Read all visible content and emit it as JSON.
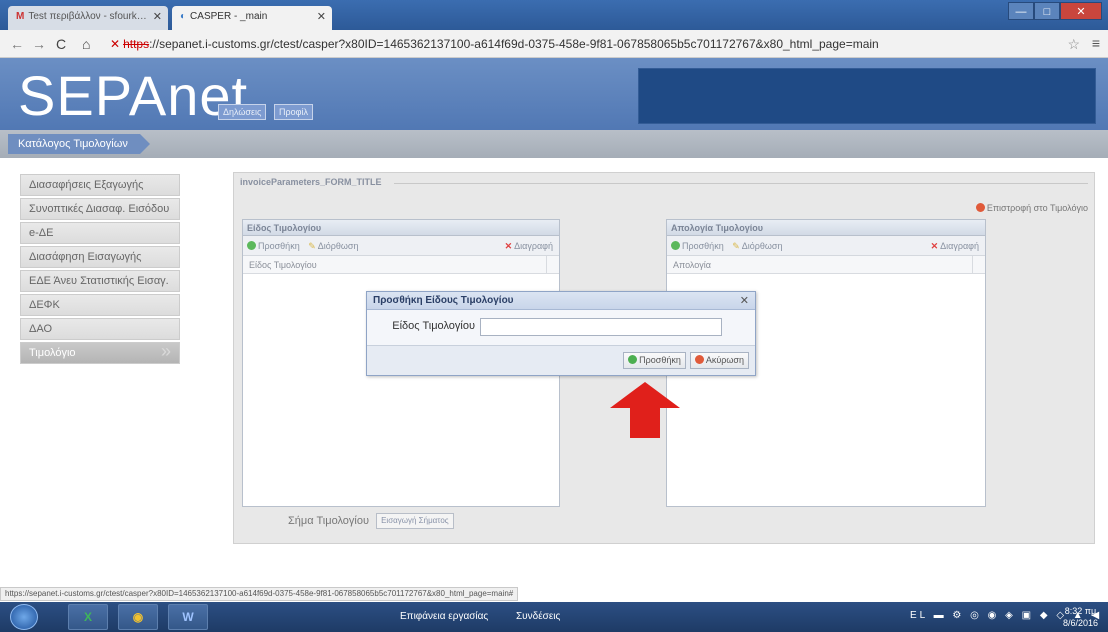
{
  "browser": {
    "tabs": [
      {
        "favicon": "M",
        "label": "Test περιβάλλον - sfourk…",
        "active": false
      },
      {
        "favicon": "◐",
        "label": "CASPER - _main",
        "active": true
      }
    ],
    "url_lock": "✕",
    "url_scheme": "https",
    "url_rest": "://sepanet.i-customs.gr/ctest/casper?x80ID=1465362137100-a614f69d-0375-458e-9f81-067858065b5c701172767&x80_html_page=main",
    "window_controls": {
      "minimize": "—",
      "maximize": "□",
      "close": "✕"
    }
  },
  "app": {
    "logo": "SEPAnet",
    "header_buttons": [
      "Δηλώσεις",
      "Προφίλ"
    ],
    "breadcrumb": "Κατάλογος Τιμολογίων"
  },
  "sidebar": {
    "items": [
      {
        "label": "Διασαφήσεις Εξαγωγής",
        "active": false
      },
      {
        "label": "Συνοπτικές Διασαφ. Εισόδου",
        "active": false
      },
      {
        "label": "e-ΔΕ",
        "active": false
      },
      {
        "label": "Διασάφηση Εισαγωγής",
        "active": false
      },
      {
        "label": "ΕΔΕ Άνευ Στατιστικής Εισαγ.",
        "active": false
      },
      {
        "label": "ΔΕΦΚ",
        "active": false
      },
      {
        "label": "ΔΑΟ",
        "active": false
      },
      {
        "label": "Τιμολόγιο",
        "active": true
      }
    ]
  },
  "form": {
    "title": "invoiceParameters_FORM_TITLE",
    "back_link": "Επιστροφή στο Τιμολόγιο",
    "left_panel": {
      "title": "Είδος Τιμολογίου",
      "add": "Προσθήκη",
      "edit": "Διόρθωση",
      "delete": "Διαγραφή",
      "column": "Είδος Τιμολογίου"
    },
    "right_panel": {
      "title": "Απολογία Τιμολογίου",
      "add": "Προσθήκη",
      "edit": "Διόρθωση",
      "delete": "Διαγραφή",
      "column": "Απολογία"
    },
    "stamp_label": "Σήμα Τιμολογίου",
    "stamp_button": "Εισαγωγή Σήματος"
  },
  "dialog": {
    "title": "Προσθήκη Είδους Τιμολογίου",
    "field_label": "Είδος Τιμολογίου",
    "field_value": "",
    "add_button": "Προσθήκη",
    "cancel_button": "Ακύρωση"
  },
  "status_url": "https://sepanet.i-customs.gr/ctest/casper?x80ID=1465362137100-a614f69d-0375-458e-9f81-067858065b5c701172767&x80_html_page=main#",
  "taskbar": {
    "apps": [
      "X",
      "◉",
      "W"
    ],
    "desktop": "Επιφάνεια εργασίας",
    "links": "Συνδέσεις",
    "tray": "EL ▬ ⚙ ◎ ◉ ◈ ▣ ◆ ◇ ▲ ◀ ▮",
    "time": "8:32 πμ",
    "date": "8/6/2016"
  },
  "colors": {
    "header": "#5b82bb",
    "accent_red": "#e0201b",
    "header_panel": "#1f4a85"
  }
}
